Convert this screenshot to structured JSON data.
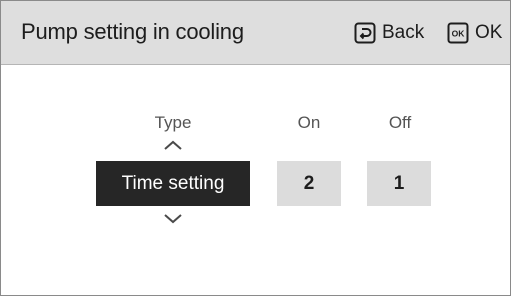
{
  "header": {
    "title": "Pump setting in cooling",
    "back_label": "Back",
    "back_icon": "back-arrow-icon",
    "ok_label": "OK",
    "ok_icon_text": "OK",
    "background_color": "#dedede"
  },
  "columns": {
    "type_label": "Type",
    "on_label": "On",
    "off_label": "Off"
  },
  "values": {
    "type": "Time setting",
    "on": "2",
    "off": "1"
  },
  "icons": {
    "up": "chevron-up-icon",
    "down": "chevron-down-icon"
  },
  "colors": {
    "selected_background": "#262626",
    "selected_text": "#ffffff",
    "value_background": "#dcdcdc"
  }
}
